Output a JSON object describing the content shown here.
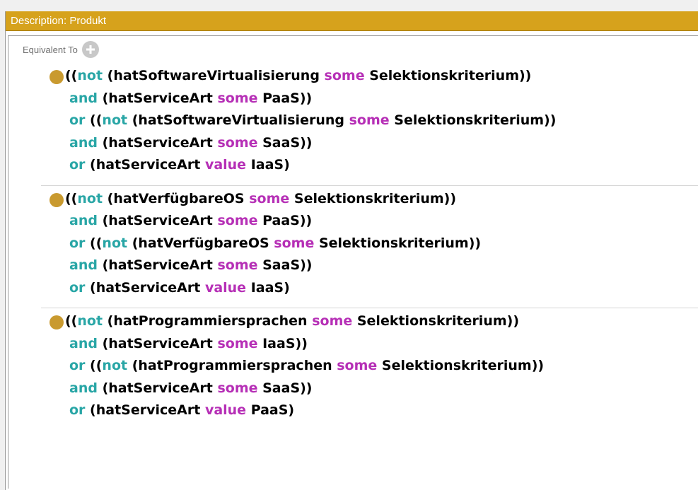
{
  "header": {
    "title": "Description: Produkt"
  },
  "section": {
    "label": "Equivalent To"
  },
  "colors": {
    "header_bg": "#d6a21c",
    "bullet": "#c99a2f",
    "keyword_operator": "#29a6a6",
    "keyword_quantifier": "#b62fb6"
  },
  "icons": {
    "add": "add-icon",
    "bullet": "class-bullet-icon"
  },
  "entries": [
    {
      "lines": [
        {
          "kind": "first",
          "tokens": [
            {
              "t": "((",
              "c": "p"
            },
            {
              "t": "not",
              "c": "op"
            },
            {
              "t": " (hatSoftwareVirtualisierung ",
              "c": "p"
            },
            {
              "t": "some",
              "c": "q"
            },
            {
              "t": " Selektionskriterium))",
              "c": "p"
            }
          ]
        },
        {
          "kind": "cont",
          "tokens": [
            {
              "t": "and",
              "c": "op"
            },
            {
              "t": " (hatServiceArt ",
              "c": "p"
            },
            {
              "t": "some",
              "c": "q"
            },
            {
              "t": " PaaS))",
              "c": "p"
            }
          ]
        },
        {
          "kind": "cont",
          "tokens": [
            {
              "t": "or",
              "c": "op"
            },
            {
              "t": " ((",
              "c": "p"
            },
            {
              "t": "not",
              "c": "op"
            },
            {
              "t": " (hatSoftwareVirtualisierung ",
              "c": "p"
            },
            {
              "t": "some",
              "c": "q"
            },
            {
              "t": " Selektionskriterium))",
              "c": "p"
            }
          ]
        },
        {
          "kind": "cont",
          "tokens": [
            {
              "t": "and",
              "c": "op"
            },
            {
              "t": " (hatServiceArt ",
              "c": "p"
            },
            {
              "t": "some",
              "c": "q"
            },
            {
              "t": " SaaS))",
              "c": "p"
            }
          ]
        },
        {
          "kind": "cont",
          "tokens": [
            {
              "t": "or",
              "c": "op"
            },
            {
              "t": " (hatServiceArt ",
              "c": "p"
            },
            {
              "t": "value",
              "c": "q"
            },
            {
              "t": " IaaS)",
              "c": "p"
            }
          ]
        }
      ]
    },
    {
      "lines": [
        {
          "kind": "first",
          "tokens": [
            {
              "t": "((",
              "c": "p"
            },
            {
              "t": "not",
              "c": "op"
            },
            {
              "t": " (hatVerfügbareOS ",
              "c": "p"
            },
            {
              "t": "some",
              "c": "q"
            },
            {
              "t": " Selektionskriterium))",
              "c": "p"
            }
          ]
        },
        {
          "kind": "cont",
          "tokens": [
            {
              "t": "and",
              "c": "op"
            },
            {
              "t": " (hatServiceArt ",
              "c": "p"
            },
            {
              "t": "some",
              "c": "q"
            },
            {
              "t": " PaaS))",
              "c": "p"
            }
          ]
        },
        {
          "kind": "cont",
          "tokens": [
            {
              "t": "or",
              "c": "op"
            },
            {
              "t": " ((",
              "c": "p"
            },
            {
              "t": "not",
              "c": "op"
            },
            {
              "t": " (hatVerfügbareOS ",
              "c": "p"
            },
            {
              "t": "some",
              "c": "q"
            },
            {
              "t": " Selektionskriterium))",
              "c": "p"
            }
          ]
        },
        {
          "kind": "cont",
          "tokens": [
            {
              "t": "and",
              "c": "op"
            },
            {
              "t": " (hatServiceArt ",
              "c": "p"
            },
            {
              "t": "some",
              "c": "q"
            },
            {
              "t": " SaaS))",
              "c": "p"
            }
          ]
        },
        {
          "kind": "cont",
          "tokens": [
            {
              "t": "or",
              "c": "op"
            },
            {
              "t": " (hatServiceArt ",
              "c": "p"
            },
            {
              "t": "value",
              "c": "q"
            },
            {
              "t": " IaaS)",
              "c": "p"
            }
          ]
        }
      ]
    },
    {
      "lines": [
        {
          "kind": "first",
          "tokens": [
            {
              "t": "((",
              "c": "p"
            },
            {
              "t": "not",
              "c": "op"
            },
            {
              "t": " (hatProgrammiersprachen ",
              "c": "p"
            },
            {
              "t": "some",
              "c": "q"
            },
            {
              "t": " Selektionskriterium))",
              "c": "p"
            }
          ]
        },
        {
          "kind": "cont",
          "tokens": [
            {
              "t": "and",
              "c": "op"
            },
            {
              "t": " (hatServiceArt ",
              "c": "p"
            },
            {
              "t": "some",
              "c": "q"
            },
            {
              "t": " IaaS))",
              "c": "p"
            }
          ]
        },
        {
          "kind": "cont",
          "tokens": [
            {
              "t": "or",
              "c": "op"
            },
            {
              "t": " ((",
              "c": "p"
            },
            {
              "t": "not",
              "c": "op"
            },
            {
              "t": " (hatProgrammiersprachen ",
              "c": "p"
            },
            {
              "t": "some",
              "c": "q"
            },
            {
              "t": " Selektionskriterium))",
              "c": "p"
            }
          ]
        },
        {
          "kind": "cont",
          "tokens": [
            {
              "t": "and",
              "c": "op"
            },
            {
              "t": " (hatServiceArt ",
              "c": "p"
            },
            {
              "t": "some",
              "c": "q"
            },
            {
              "t": " SaaS))",
              "c": "p"
            }
          ]
        },
        {
          "kind": "cont",
          "tokens": [
            {
              "t": "or",
              "c": "op"
            },
            {
              "t": " (hatServiceArt ",
              "c": "p"
            },
            {
              "t": "value",
              "c": "q"
            },
            {
              "t": " PaaS)",
              "c": "p"
            }
          ]
        }
      ]
    }
  ]
}
